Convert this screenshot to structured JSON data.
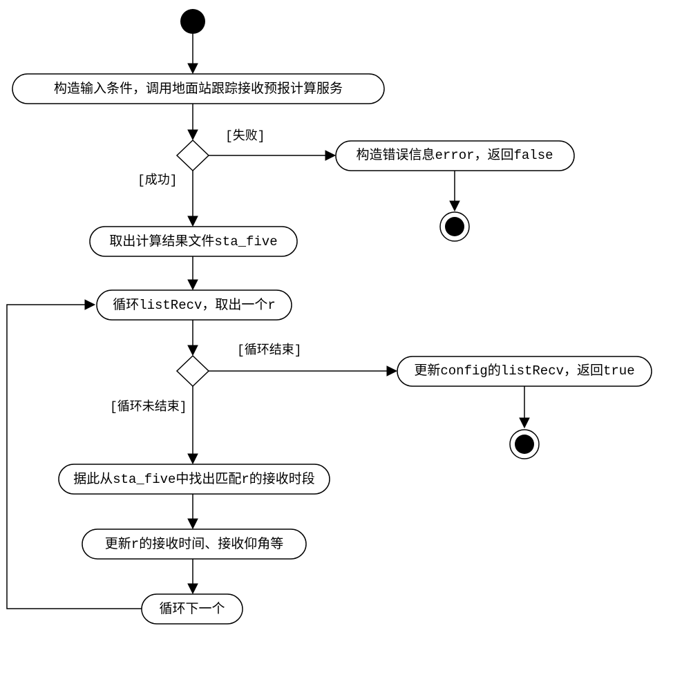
{
  "nodes": {
    "n1": "构造输入条件，调用地面站跟踪接收预报计算服务",
    "n2": "构造错误信息error，返回false",
    "n3": "取出计算结果文件sta_five",
    "n4": "循环listRecv，取出一个r",
    "n5": "更新config的listRecv，返回true",
    "n6": "据此从sta_five中找出匹配r的接收时段",
    "n7": "更新r的接收时间、接收仰角等",
    "n8": "循环下一个"
  },
  "labels": {
    "fail": "[失败]",
    "success": "[成功]",
    "loop_end": "[循环结束]",
    "loop_continue": "[循环未结束]"
  }
}
